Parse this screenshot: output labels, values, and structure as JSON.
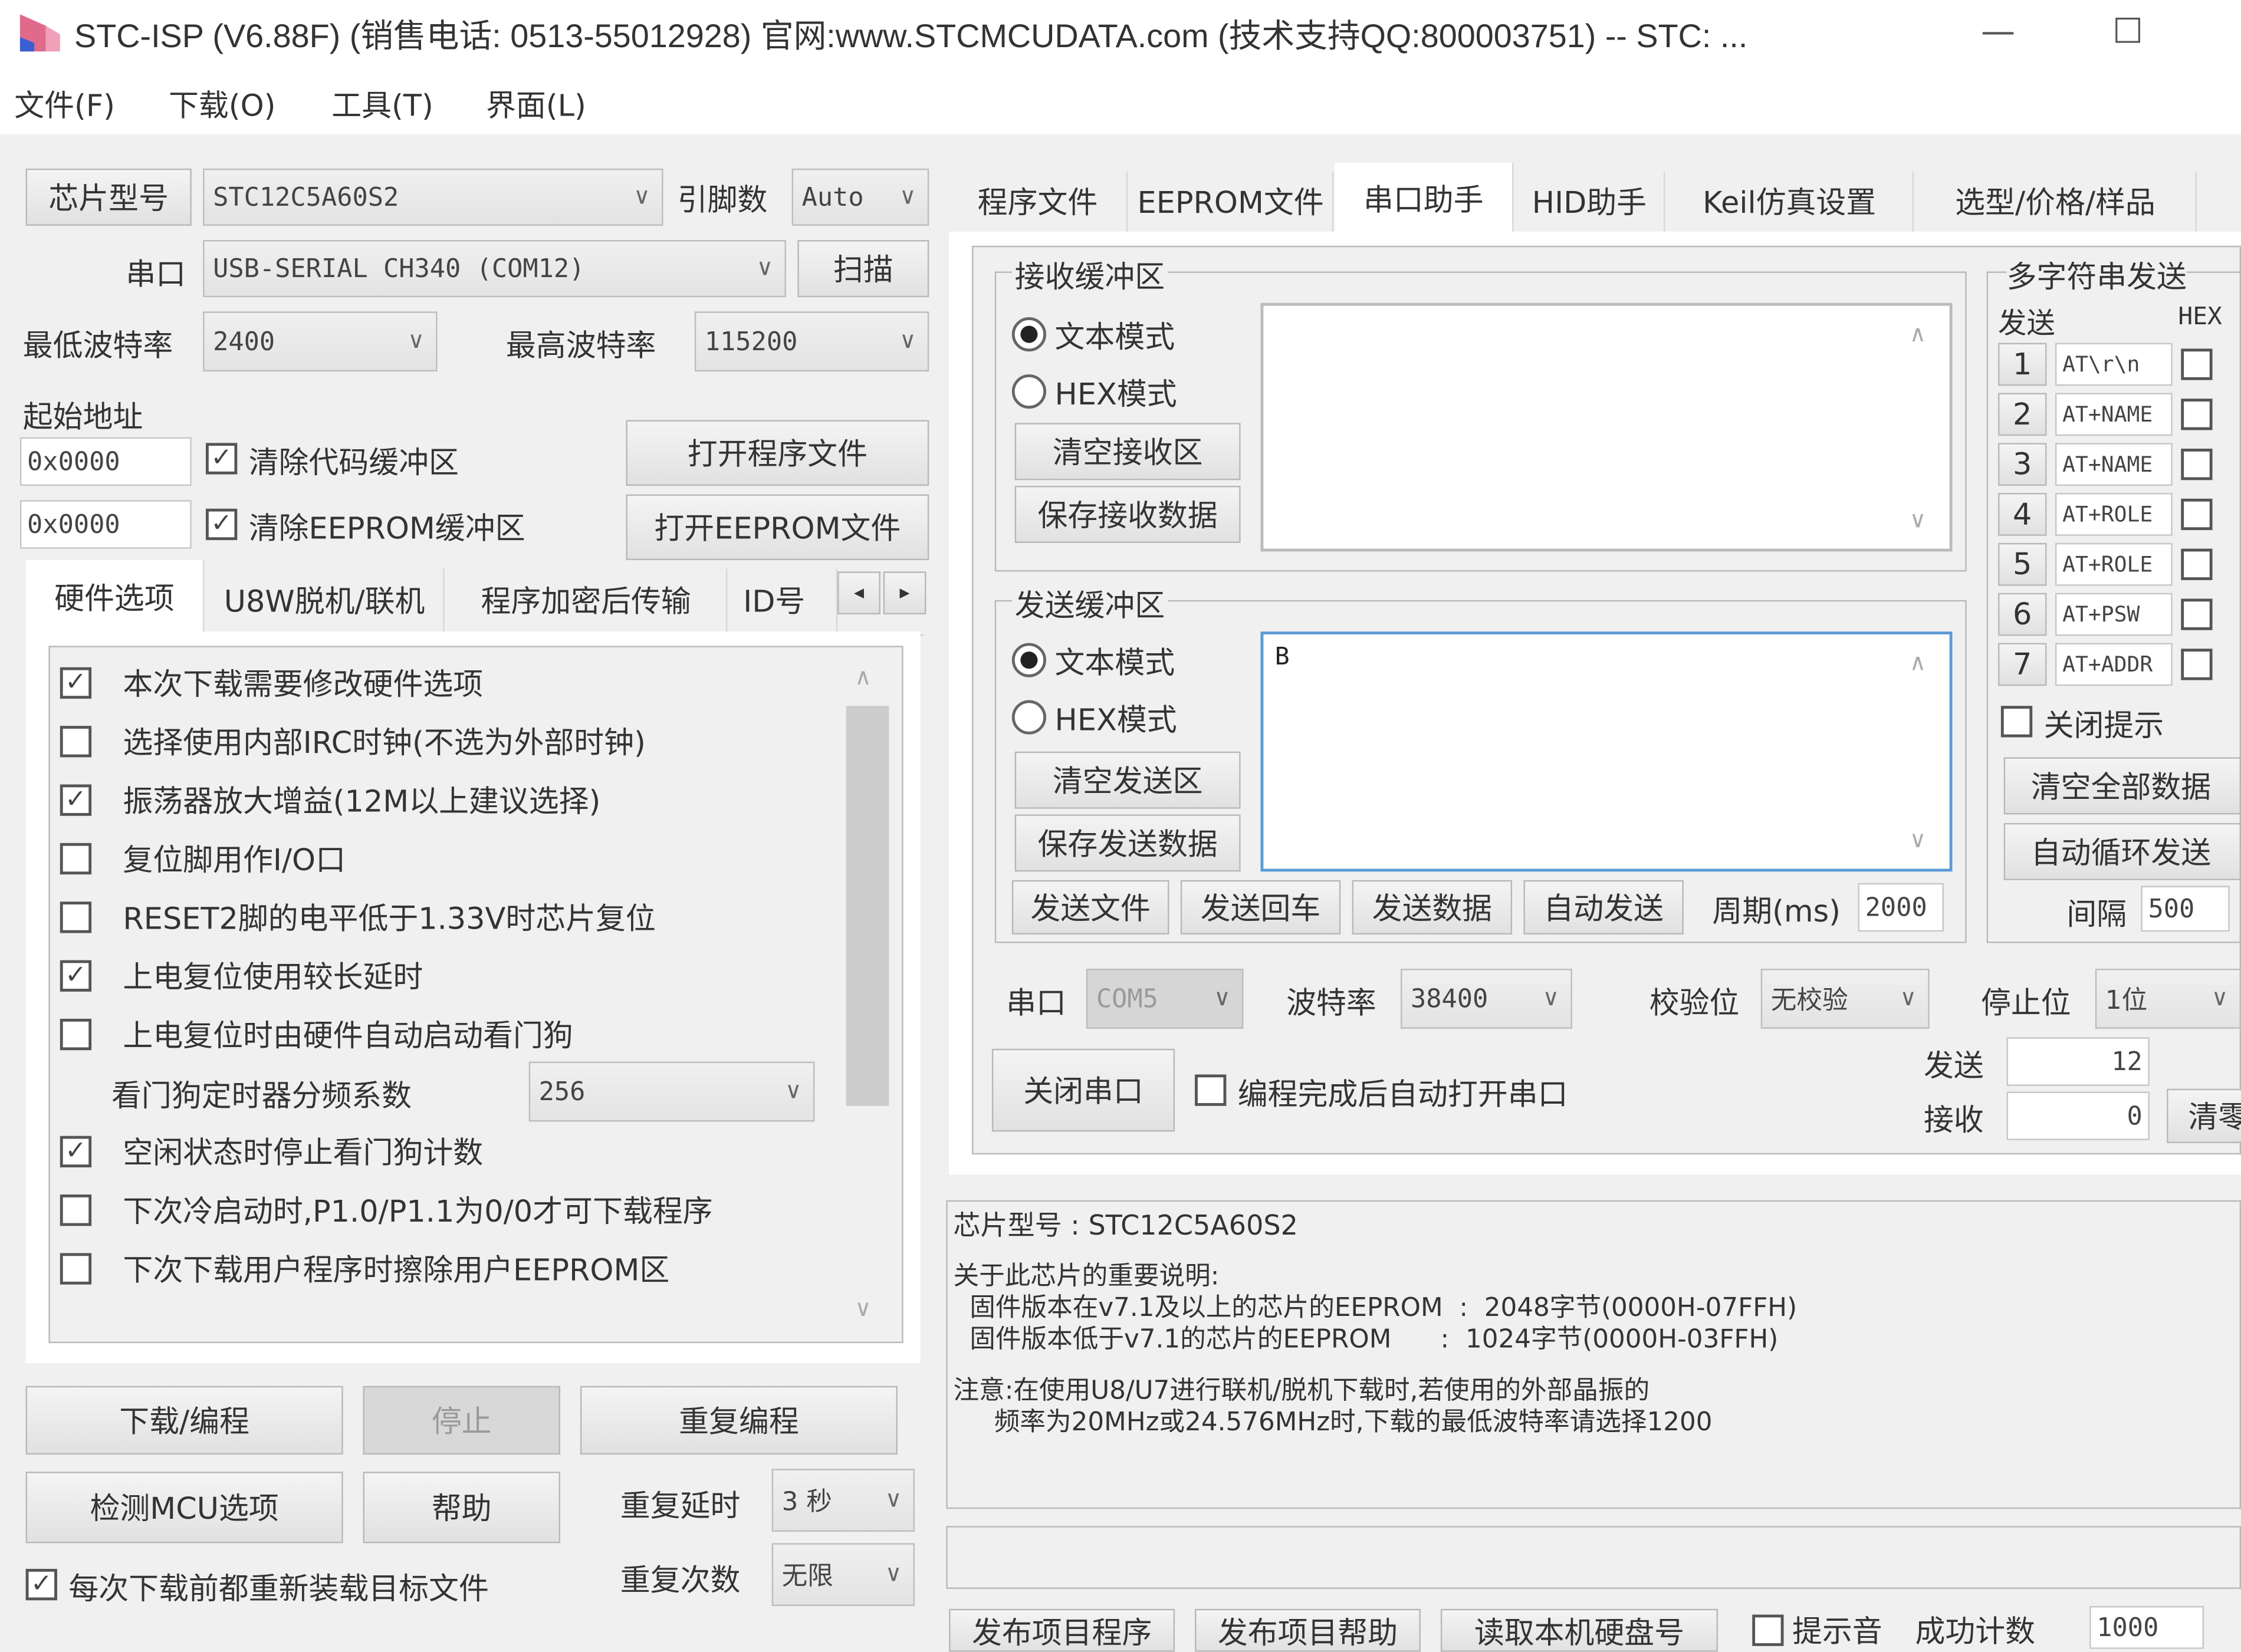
{
  "window": {
    "title": "STC-ISP (V6.88F) (销售电话: 0513-55012928) 官网:www.STCMCUDATA.com  (技术支持QQ:800003751) -- STC: ...",
    "minimize": "—",
    "maximize": "☐"
  },
  "menu": [
    "文件(F)",
    "下载(O)",
    "工具(T)",
    "界面(L)"
  ],
  "left": {
    "chip_label": "芯片型号",
    "chip_value": "STC12C5A60S2",
    "pins_label": "引脚数",
    "pins_value": "Auto",
    "port_label": "串口",
    "port_value": "USB-SERIAL CH340 (COM12)",
    "scan_button": "扫描",
    "min_baud_label": "最低波特率",
    "min_baud_value": "2400",
    "max_baud_label": "最高波特率",
    "max_baud_value": "115200",
    "start_addr_label": "起始地址",
    "addr1": "0x0000",
    "addr2": "0x0000",
    "clear_code_label": "清除代码缓冲区",
    "clear_code_checked": true,
    "clear_eeprom_label": "清除EEPROM缓冲区",
    "clear_eeprom_checked": true,
    "open_program_button": "打开程序文件",
    "open_eeprom_button": "打开EEPROM文件",
    "tabs": [
      "硬件选项",
      "U8W脱机/联机",
      "程序加密后传输",
      "ID号"
    ],
    "tab_prev": "◂",
    "tab_next": "▸",
    "hw_options": [
      {
        "label": "本次下载需要修改硬件选项",
        "checked": true
      },
      {
        "label": "选择使用内部IRC时钟(不选为外部时钟)",
        "checked": false
      },
      {
        "label": "振荡器放大增益(12M以上建议选择)",
        "checked": true
      },
      {
        "label": "复位脚用作I/O口",
        "checked": false
      },
      {
        "label": "RESET2脚的电平低于1.33V时芯片复位",
        "checked": false
      },
      {
        "label": "上电复位使用较长延时",
        "checked": true
      },
      {
        "label": "上电复位时由硬件自动启动看门狗",
        "checked": false
      }
    ],
    "wdt_label": "看门狗定时器分频系数",
    "wdt_value": "256",
    "hw_options2": [
      {
        "label": "空闲状态时停止看门狗计数",
        "checked": true
      },
      {
        "label": "下次冷启动时,P1.0/P1.1为0/0才可下载程序",
        "checked": false
      },
      {
        "label": "下次下载用户程序时擦除用户EEPROM区",
        "checked": false
      }
    ],
    "download_button": "下载/编程",
    "stop_button": "停止",
    "reprogram_button": "重复编程",
    "check_mcu_button": "检测MCU选项",
    "help_button": "帮助",
    "repeat_delay_label": "重复延时",
    "repeat_delay_value": "3 秒",
    "repeat_count_label": "重复次数",
    "repeat_count_value": "无限",
    "reload_label": "每次下载前都重新装载目标文件",
    "reload_checked": true
  },
  "right": {
    "tabs": [
      "程序文件",
      "EEPROM文件",
      "串口助手",
      "HID助手",
      "Keil仿真设置",
      "选型/价格/样品"
    ],
    "active_tab": 2,
    "receive": {
      "title": "接收缓冲区",
      "text_mode": "文本模式",
      "hex_mode": "HEX模式",
      "text_selected": true,
      "clear_button": "清空接收区",
      "save_button": "保存接收数据",
      "content": ""
    },
    "send": {
      "title": "发送缓冲区",
      "text_mode": "文本模式",
      "hex_mode": "HEX模式",
      "text_selected": true,
      "clear_button": "清空发送区",
      "save_button": "保存发送数据",
      "content": "B",
      "send_file": "发送文件",
      "send_enter": "发送回车",
      "send_data": "发送数据",
      "auto_send": "自动发送",
      "period_label": "周期(ms)",
      "period_value": "2000"
    },
    "multi": {
      "title": "多字符串发送",
      "send_header": "发送",
      "hex_header": "HEX",
      "rows": [
        {
          "num": "1",
          "text": "AT\\r\\n",
          "hex": false
        },
        {
          "num": "2",
          "text": "AT+NAME",
          "hex": false
        },
        {
          "num": "3",
          "text": "AT+NAME",
          "hex": false
        },
        {
          "num": "4",
          "text": "AT+ROLE",
          "hex": false
        },
        {
          "num": "5",
          "text": "AT+ROLE",
          "hex": false
        },
        {
          "num": "6",
          "text": "AT+PSW",
          "hex": false
        },
        {
          "num": "7",
          "text": "AT+ADDR",
          "hex": false
        }
      ],
      "close_hint_label": "关闭提示",
      "close_hint_checked": false,
      "clear_all_button": "清空全部数据",
      "auto_loop_button": "自动循环发送",
      "interval_label": "间隔",
      "interval_value": "500"
    },
    "serial": {
      "port_label": "串口",
      "port_value": "COM5",
      "baud_label": "波特率",
      "baud_value": "38400",
      "parity_label": "校验位",
      "parity_value": "无校验",
      "stop_label": "停止位",
      "stop_value": "1位",
      "close_button": "关闭串口",
      "auto_open_label": "编程完成后自动打开串口",
      "auto_open_checked": false,
      "sent_label": "发送",
      "sent_value": "12",
      "recv_label": "接收",
      "recv_value": "0",
      "clear_count_button": "清零"
    },
    "info": {
      "line1": "芯片型号 : STC12C5A60S2",
      "line2": "关于此芯片的重要说明:",
      "line3": "  固件版本在v7.1及以上的芯片的EEPROM  :  2048字节(0000H-07FFH)",
      "line4": "  固件版本低于v7.1的芯片的EEPROM      :  1024字节(0000H-03FFH)",
      "line5": "注意:在使用U8/U7进行联机/脱机下载时,若使用的外部晶振的",
      "line6": "     频率为20MHz或24.576MHz时,下载的最低波特率请选择1200"
    },
    "status_text": "",
    "bottom_buttons": [
      "发布项目程序",
      "发布项目帮助",
      "读取本机硬盘号"
    ],
    "beep_label": "提示音",
    "success_count_label": "成功计数",
    "success_count_value": "1000"
  },
  "colors": {
    "focus_border": "#5b9bd5",
    "background": "#f0f0f0"
  }
}
